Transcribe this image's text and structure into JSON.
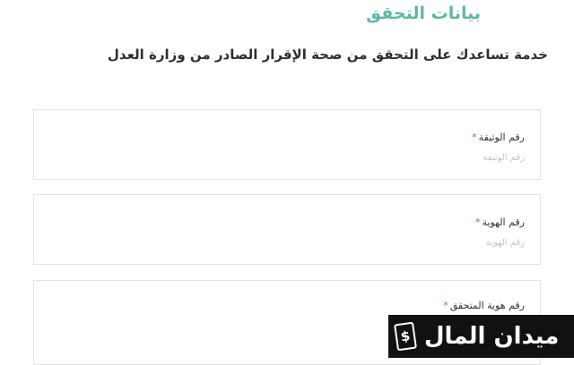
{
  "header": {
    "title": "بيانات التحقق",
    "description": "خدمة تساعدك على التحقق من صحة الإقرار الصادر من وزارة العدل"
  },
  "form": {
    "fields": [
      {
        "label": "رقم الوثيقة",
        "required_mark": "*",
        "placeholder": "رقم الوثيقة",
        "value": ""
      },
      {
        "label": "رقم الهوية",
        "required_mark": "*",
        "placeholder": "رقم الهوية",
        "value": ""
      },
      {
        "label": "رقم هوية المتحقق",
        "required_mark": "*",
        "placeholder": "",
        "value": ""
      }
    ]
  },
  "watermark": {
    "text": "ميدان المال",
    "icon": "dollar-tag-icon",
    "icon_glyph": "$"
  },
  "colors": {
    "accent": "#5fb8a6",
    "required": "#d9534f",
    "watermark_bg": "#111111"
  }
}
